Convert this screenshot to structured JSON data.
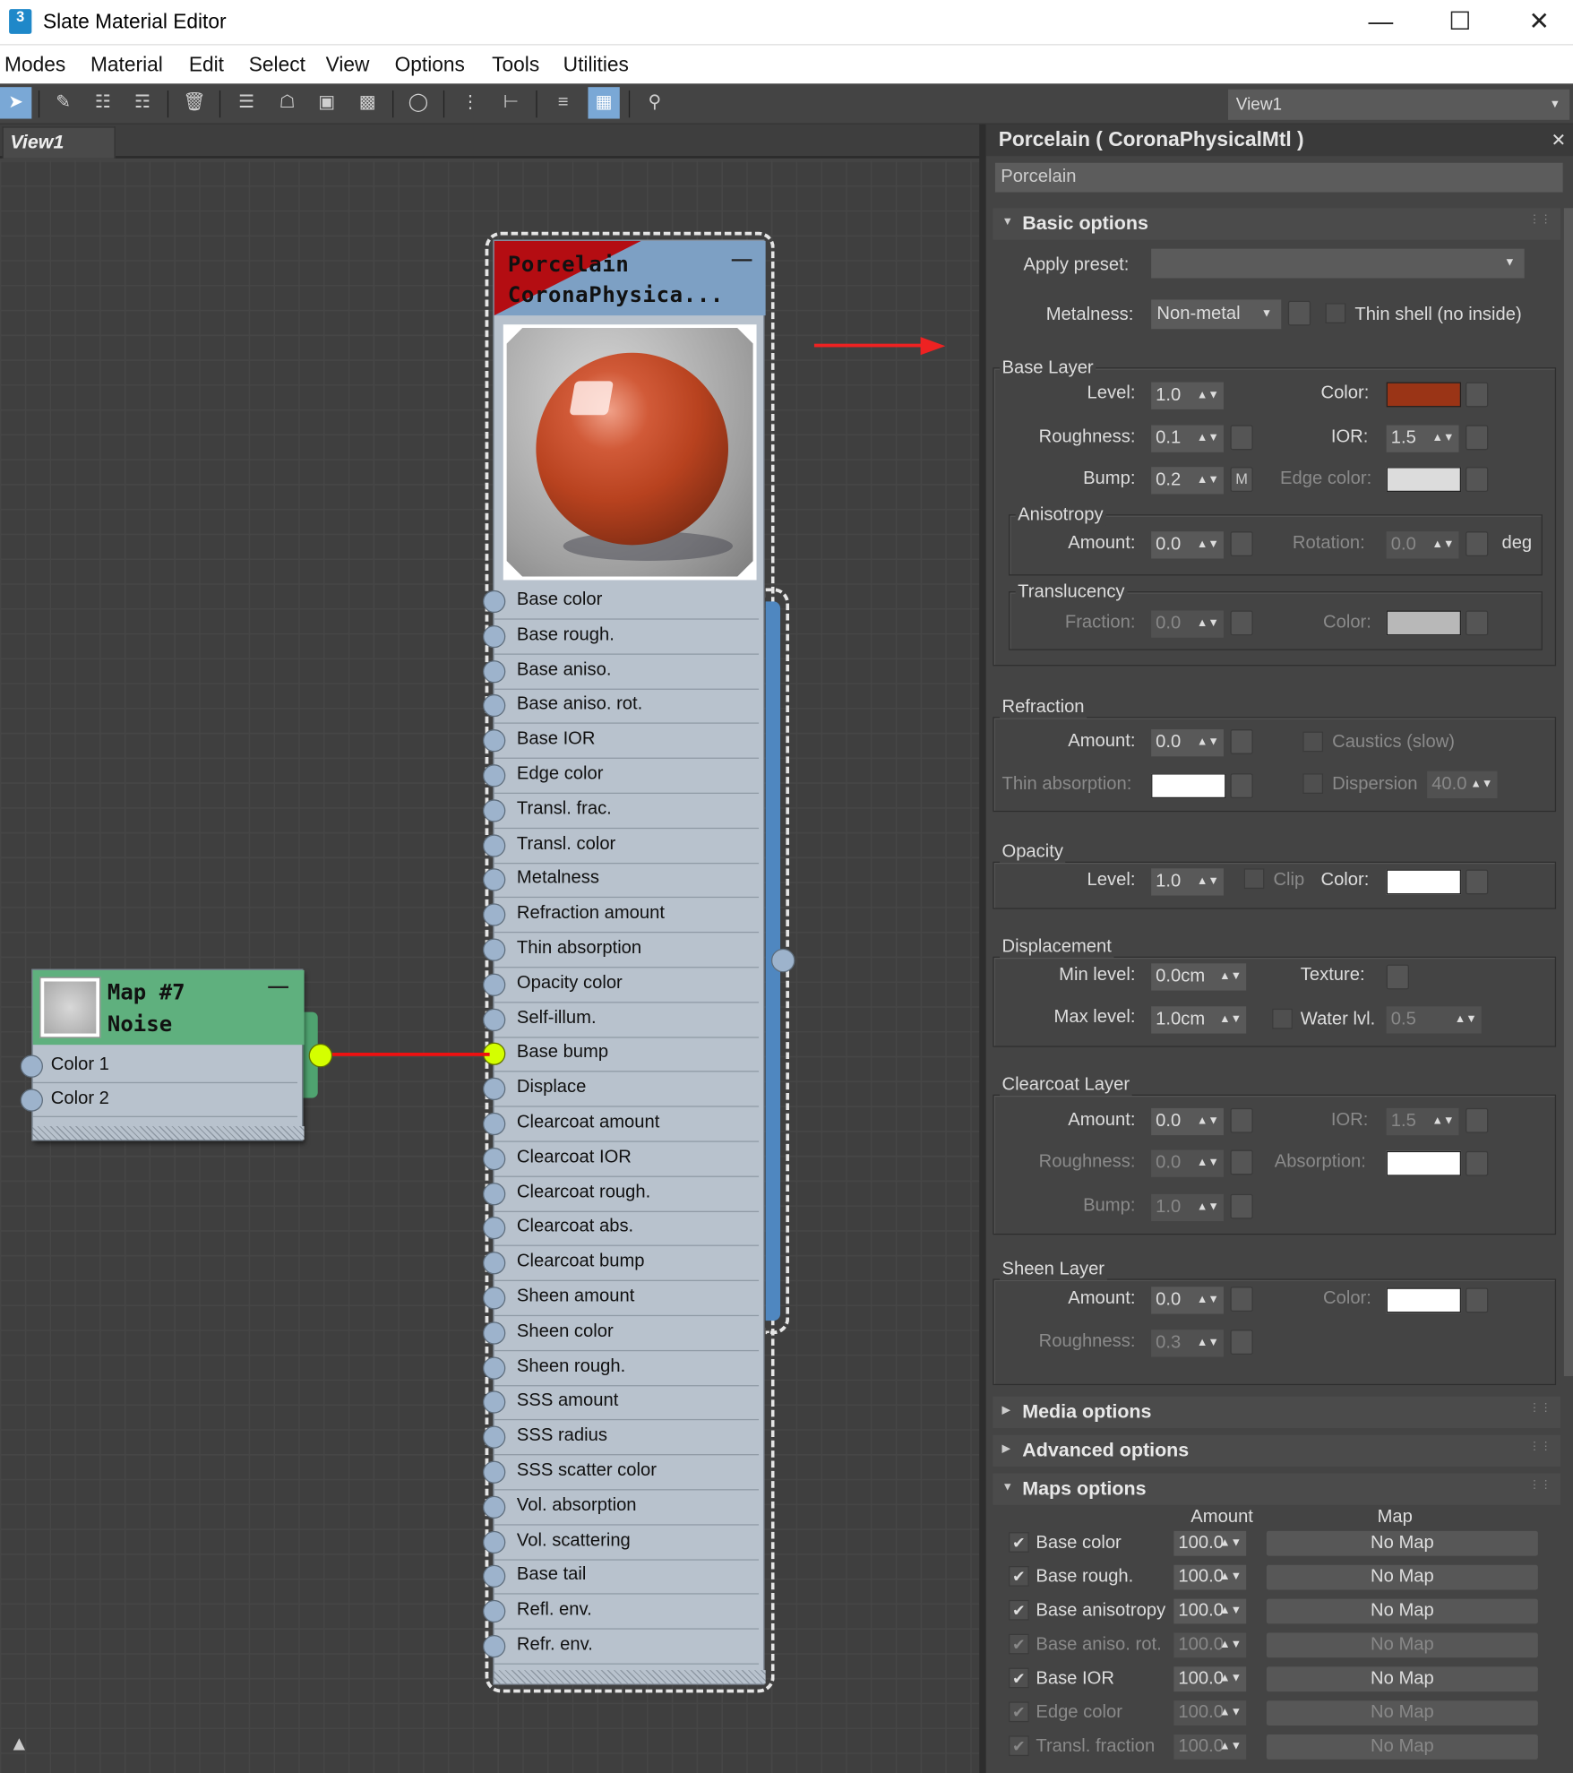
{
  "window": {
    "title": "Slate Material Editor",
    "app_icon": "3"
  },
  "menu": [
    "Modes",
    "Material",
    "Edit",
    "Select",
    "View",
    "Options",
    "Tools",
    "Utilities"
  ],
  "toolbar": {
    "view_select": "View1"
  },
  "view_tab": "View1",
  "material_node": {
    "line1": "Porcelain",
    "line2": "CoronaPhysica...",
    "slots": [
      "Base color",
      "Base rough.",
      "Base aniso.",
      "Base aniso. rot.",
      "Base IOR",
      "Edge color",
      "Transl. frac.",
      "Transl. color",
      "Metalness",
      "Refraction amount",
      "Thin absorption",
      "Opacity color",
      "Self-illum.",
      "Base bump",
      "Displace",
      "Clearcoat amount",
      "Clearcoat IOR",
      "Clearcoat rough.",
      "Clearcoat abs.",
      "Clearcoat bump",
      "Sheen amount",
      "Sheen color",
      "Sheen rough.",
      "SSS amount",
      "SSS radius",
      "SSS scatter color",
      "Vol. absorption",
      "Vol. scattering",
      "Base tail",
      "Refl. env.",
      "Refr. env."
    ]
  },
  "noise_node": {
    "line1": "Map #7",
    "line2": "Noise",
    "slots": [
      "Color 1",
      "Color 2"
    ]
  },
  "panel": {
    "title": "Porcelain  ( CoronaPhysicalMtl )",
    "name": "Porcelain",
    "basic_options": "Basic options",
    "apply_preset_label": "Apply preset:",
    "apply_preset_value": "",
    "metalness_label": "Metalness:",
    "metalness_value": "Non-metal",
    "thin_shell": "Thin shell (no inside)",
    "base_layer": {
      "title": "Base Layer",
      "level_label": "Level:",
      "level": "1.0",
      "color_label": "Color:",
      "color": "#9a3416",
      "roughness_label": "Roughness:",
      "roughness": "0.1",
      "ior_label": "IOR:",
      "ior": "1.5",
      "bump_label": "Bump:",
      "bump": "0.2",
      "bump_map": "M",
      "edge_color_label": "Edge color:",
      "edge_color": "#dcdcdc"
    },
    "anisotropy": {
      "title": "Anisotropy",
      "amount_label": "Amount:",
      "amount": "0.0",
      "rotation_label": "Rotation:",
      "rotation": "0.0",
      "unit": "deg"
    },
    "translucency": {
      "title": "Translucency",
      "fraction_label": "Fraction:",
      "fraction": "0.0",
      "color_label": "Color:",
      "color": "#b8b8b8"
    },
    "refraction": {
      "title": "Refraction",
      "amount_label": "Amount:",
      "amount": "0.0",
      "caustics": "Caustics (slow)",
      "thin_abs_label": "Thin absorption:",
      "thin_abs_color": "#ffffff",
      "dispersion": "Dispersion",
      "dispersion_value": "40.0"
    },
    "opacity": {
      "title": "Opacity",
      "level_label": "Level:",
      "level": "1.0",
      "clip": "Clip",
      "color_label": "Color:",
      "color": "#ffffff"
    },
    "displacement": {
      "title": "Displacement",
      "min_label": "Min level:",
      "min": "0.0cm",
      "texture_label": "Texture:",
      "max_label": "Max level:",
      "max": "1.0cm",
      "water_label": "Water lvl.",
      "water": "0.5"
    },
    "clearcoat": {
      "title": "Clearcoat Layer",
      "amount_label": "Amount:",
      "amount": "0.0",
      "ior_label": "IOR:",
      "ior": "1.5",
      "roughness_label": "Roughness:",
      "roughness": "0.0",
      "absorption_label": "Absorption:",
      "absorption_color": "#ffffff",
      "bump_label": "Bump:",
      "bump": "1.0"
    },
    "sheen": {
      "title": "Sheen Layer",
      "amount_label": "Amount:",
      "amount": "0.0",
      "color_label": "Color:",
      "color": "#ffffff",
      "roughness_label": "Roughness:",
      "roughness": "0.3"
    },
    "media_options": "Media options",
    "advanced_options": "Advanced options",
    "maps_options": "Maps options",
    "maps_header": {
      "amount": "Amount",
      "map": "Map"
    },
    "maps": [
      {
        "label": "Base color",
        "amount": "100.0",
        "map": "No Map",
        "enabled": true
      },
      {
        "label": "Base rough.",
        "amount": "100.0",
        "map": "No Map",
        "enabled": true
      },
      {
        "label": "Base anisotropy",
        "amount": "100.0",
        "map": "No Map",
        "enabled": true
      },
      {
        "label": "Base aniso. rot.",
        "amount": "100.0",
        "map": "No Map",
        "enabled": false
      },
      {
        "label": "Base IOR",
        "amount": "100.0",
        "map": "No Map",
        "enabled": true
      },
      {
        "label": "Edge color",
        "amount": "100.0",
        "map": "No Map",
        "enabled": false
      },
      {
        "label": "Transl. fraction",
        "amount": "100.0",
        "map": "No Map",
        "enabled": false
      }
    ]
  }
}
